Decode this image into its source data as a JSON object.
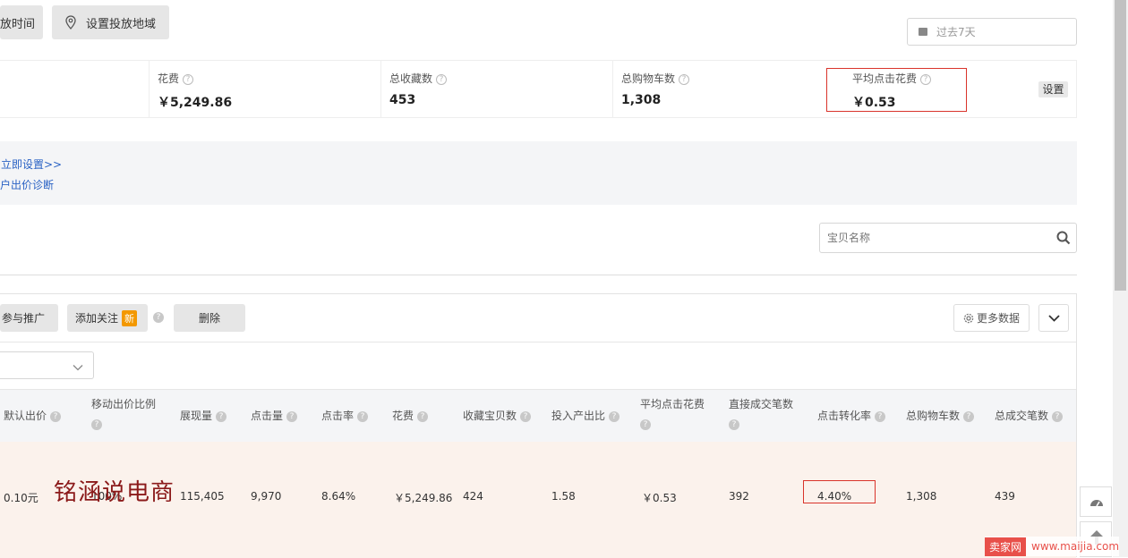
{
  "toolbar": {
    "time_button_label": "放时间",
    "region_button_label": "设置投放地域",
    "date_range_placeholder": "过去7天"
  },
  "metrics": [
    {
      "label": "花费",
      "value": "￥5,249.86"
    },
    {
      "label": "总收藏数",
      "value": "453"
    },
    {
      "label": "总购物车数",
      "value": "1,308"
    },
    {
      "label": "平均点击花费",
      "value": "￥0.53"
    }
  ],
  "settings_label": "设置",
  "notice": {
    "link1": "立即设置>>",
    "link2": "户出价诊断"
  },
  "search": {
    "placeholder": "宝贝名称"
  },
  "actions": {
    "participate": "参与推广",
    "add_follow": "添加关注",
    "new_badge": "新",
    "delete": "删除",
    "more_data": "更多数据"
  },
  "table": {
    "headers": [
      "默认出价",
      "移动出价比例",
      "展现量",
      "点击量",
      "点击率",
      "花费",
      "收藏宝贝数",
      "投入产出比",
      "平均点击花费",
      "直接成交笔数",
      "点击转化率",
      "总购物车数",
      "总成交笔数"
    ],
    "row": [
      "0.10元",
      "100%",
      "115,405",
      "9,970",
      "8.64%",
      "￥5,249.86",
      "424",
      "1.58",
      "￥0.53",
      "392",
      "4.40%",
      "1,308",
      "439"
    ]
  },
  "watermark": "铭涵说电商",
  "footer_watermark": {
    "brand": "卖家网",
    "url": "www.maijia.com"
  },
  "colors": {
    "highlight_red": "#d9342b",
    "row_bg": "#fbf2ec",
    "link": "#2a62c4",
    "badge": "#f39800"
  }
}
